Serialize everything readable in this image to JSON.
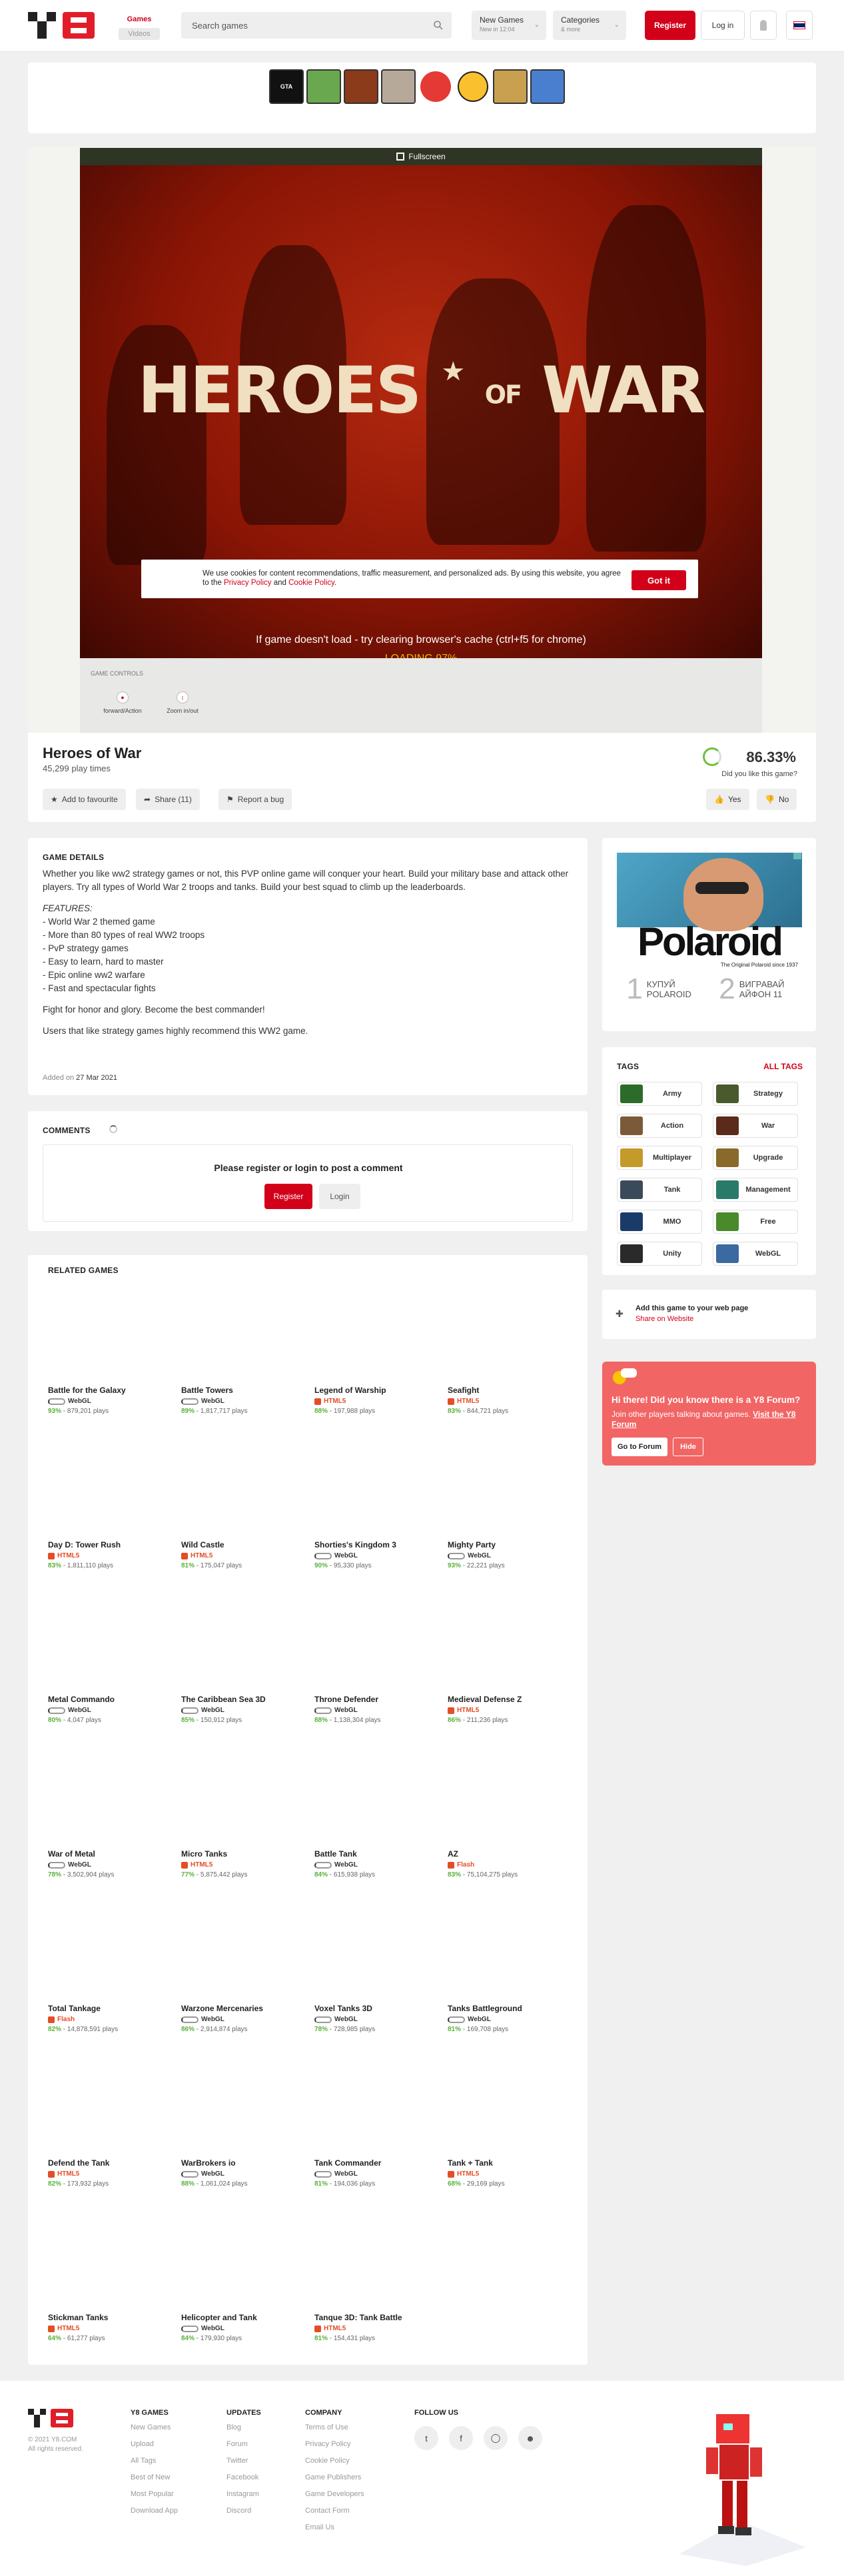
{
  "header": {
    "tab_games": "Games",
    "tab_videos": "Videos",
    "search_placeholder": "Search games",
    "new_games_title": "New Games",
    "new_games_sub": "New in 12:04",
    "categories_title": "Categories",
    "categories_sub": "& more",
    "register": "Register",
    "login": "Log in"
  },
  "game": {
    "fullscreen": "Fullscreen",
    "title_art_left": "HEROES",
    "title_art_of": "OF",
    "title_art_right": "WAR",
    "cookie_text_1": "We use cookies for content recommendations, traffic measurement, and personalized ads. By using this website, you agree to the ",
    "privacy_policy": "Privacy Policy",
    "cookie_and": " and ",
    "cookie_policy": "Cookie Policy",
    "cookie_end": ".",
    "got_it": "Got it",
    "load_hint": "If game doesn't load - try clearing browser's cache (ctrl+f5 for chrome)",
    "loading": "LOADING 97%",
    "controls_label": "GAME CONTROLS",
    "control_1": "forward/Action",
    "control_2": "Zoom in/out",
    "name": "Heroes of War",
    "plays": "45,299 play times",
    "add_fav": "Add to favourite",
    "share": "Share (11)",
    "report": "Report a bug",
    "rating": "86.33%",
    "like_q": "Did you like this game?",
    "yes": "Yes",
    "no": "No"
  },
  "details": {
    "title": "GAME DETAILS",
    "p1": "Whether you like ww2 strategy games or not, this PVP online game will conquer your heart. Build your military base and attack other players. Try all types of World War 2 troops and tanks. Build your best squad to climb up the leaderboards.",
    "features_label": "FEATURES:",
    "features": [
      "- World War 2 themed game",
      "- More than 80 types of real WW2 troops",
      "- PvP strategy games",
      "- Easy to learn, hard to master",
      "- Epic online ww2 warfare",
      "- Fast and spectacular fights"
    ],
    "p2": "Fight for honor and glory. Become the best commander!",
    "p3": "Users that like strategy games highly recommend this WW2 game.",
    "added_label": "Added on",
    "added_date": "27 Mar 2021"
  },
  "comments": {
    "title": "COMMENTS",
    "msg": "Please register or login to post a comment",
    "register": "Register",
    "login": "Login"
  },
  "related": {
    "title": "RELATED GAMES",
    "games": [
      {
        "name": "Battle for the Galaxy",
        "tech": "WebGL",
        "pct": "93%",
        "plays": "879,201 plays"
      },
      {
        "name": "Battle Towers",
        "tech": "WebGL",
        "pct": "89%",
        "plays": "1,817,717 plays"
      },
      {
        "name": "Legend of Warship",
        "tech": "HTML5",
        "pct": "88%",
        "plays": "197,988 plays"
      },
      {
        "name": "Seafight",
        "tech": "HTML5",
        "pct": "83%",
        "plays": "844,721 plays"
      },
      {
        "name": "Day D: Tower Rush",
        "tech": "HTML5",
        "pct": "83%",
        "plays": "1,811,110 plays"
      },
      {
        "name": "Wild Castle",
        "tech": "HTML5",
        "pct": "81%",
        "plays": "175,047 plays"
      },
      {
        "name": "Shorties's Kingdom 3",
        "tech": "WebGL",
        "pct": "90%",
        "plays": "95,330 plays"
      },
      {
        "name": "Mighty Party",
        "tech": "WebGL",
        "pct": "93%",
        "plays": "22,221 plays"
      },
      {
        "name": "Metal Commando",
        "tech": "WebGL",
        "pct": "80%",
        "plays": "4,047 plays"
      },
      {
        "name": "The Caribbean Sea 3D",
        "tech": "WebGL",
        "pct": "85%",
        "plays": "150,912 plays"
      },
      {
        "name": "Throne Defender",
        "tech": "WebGL",
        "pct": "88%",
        "plays": "1,138,304 plays"
      },
      {
        "name": "Medieval Defense Z",
        "tech": "HTML5",
        "pct": "86%",
        "plays": "211,236 plays"
      },
      {
        "name": "War of Metal",
        "tech": "WebGL",
        "pct": "78%",
        "plays": "3,502,904 plays"
      },
      {
        "name": "Micro Tanks",
        "tech": "HTML5",
        "pct": "77%",
        "plays": "5,875,442 plays"
      },
      {
        "name": "Battle Tank",
        "tech": "WebGL",
        "pct": "84%",
        "plays": "615,938 plays"
      },
      {
        "name": "AZ",
        "tech": "Flash",
        "pct": "83%",
        "plays": "75,104,275 plays"
      },
      {
        "name": "Total Tankage",
        "tech": "Flash",
        "pct": "82%",
        "plays": "14,878,591 plays"
      },
      {
        "name": "Warzone Mercenaries",
        "tech": "WebGL",
        "pct": "86%",
        "plays": "2,914,874 plays"
      },
      {
        "name": "Voxel Tanks 3D",
        "tech": "WebGL",
        "pct": "78%",
        "plays": "728,985 plays"
      },
      {
        "name": "Tanks Battleground",
        "tech": "WebGL",
        "pct": "81%",
        "plays": "169,708 plays"
      },
      {
        "name": "Defend the Tank",
        "tech": "HTML5",
        "pct": "82%",
        "plays": "173,932 plays"
      },
      {
        "name": "WarBrokers io",
        "tech": "WebGL",
        "pct": "88%",
        "plays": "1,061,024 plays"
      },
      {
        "name": "Tank Commander",
        "tech": "WebGL",
        "pct": "81%",
        "plays": "194,036 plays"
      },
      {
        "name": "Tank + Tank",
        "tech": "HTML5",
        "pct": "68%",
        "plays": "29,169 plays"
      },
      {
        "name": "Stickman Tanks",
        "tech": "HTML5",
        "pct": "64%",
        "plays": "61,277 plays"
      },
      {
        "name": "Helicopter and Tank",
        "tech": "WebGL",
        "pct": "84%",
        "plays": "179,930 plays"
      },
      {
        "name": "Tanque 3D: Tank Battle",
        "tech": "HTML5",
        "pct": "81%",
        "plays": "154,431 plays"
      }
    ]
  },
  "ad": {
    "brand": "Polaroid",
    "sub": "The Original Polaroid since 1937",
    "step1_n": "1",
    "step1": "КУПУЙ POLAROID",
    "step2_n": "2",
    "step2": "ВИГРАВАЙ АЙФОН 11"
  },
  "tags": {
    "title": "TAGS",
    "all": "ALL TAGS",
    "items": [
      "Army",
      "Strategy",
      "Action",
      "War",
      "Multiplayer",
      "Upgrade",
      "Tank",
      "Management",
      "MMO",
      "Free",
      "Unity",
      "WebGL"
    ],
    "colors": [
      "#2d6b2a",
      "#4a5a2c",
      "#7b5a3a",
      "#5a2a1a",
      "#c49a2a",
      "#8a6a2a",
      "#3a4a5a",
      "#2a7a6a",
      "#1a3a6a",
      "#4a8a2a",
      "#2a2a2a",
      "#3a6aa0"
    ]
  },
  "addsite": {
    "title": "Add this game to your web page",
    "link": "Share on Website"
  },
  "forum": {
    "heading": "Hi there! Did you know there is a Y8 Forum?",
    "text": "Join other players talking about games.",
    "link": "Visit the Y8 Forum",
    "go": "Go to Forum",
    "hide": "Hide"
  },
  "footer": {
    "copy1": "© 2021 Y8.COM",
    "copy2": "All rights reserved.",
    "col1_title": "Y8 GAMES",
    "col1": [
      "New Games",
      "Upload",
      "All Tags",
      "Best of New",
      "Most Popular",
      "Download App"
    ],
    "col2_title": "UPDATES",
    "col2": [
      "Blog",
      "Forum",
      "Twitter",
      "Facebook",
      "Instagram",
      "Discord"
    ],
    "col3_title": "COMPANY",
    "col3": [
      "Terms of Use",
      "Privacy Policy",
      "Cookie Policy",
      "Game Publishers",
      "Game Developers",
      "Contact Form",
      "Email Us"
    ],
    "follow_title": "FOLLOW US"
  },
  "colors": {
    "accent": "#d20019",
    "rating_green": "#5bb13a",
    "forum_bg": "#f26565"
  }
}
